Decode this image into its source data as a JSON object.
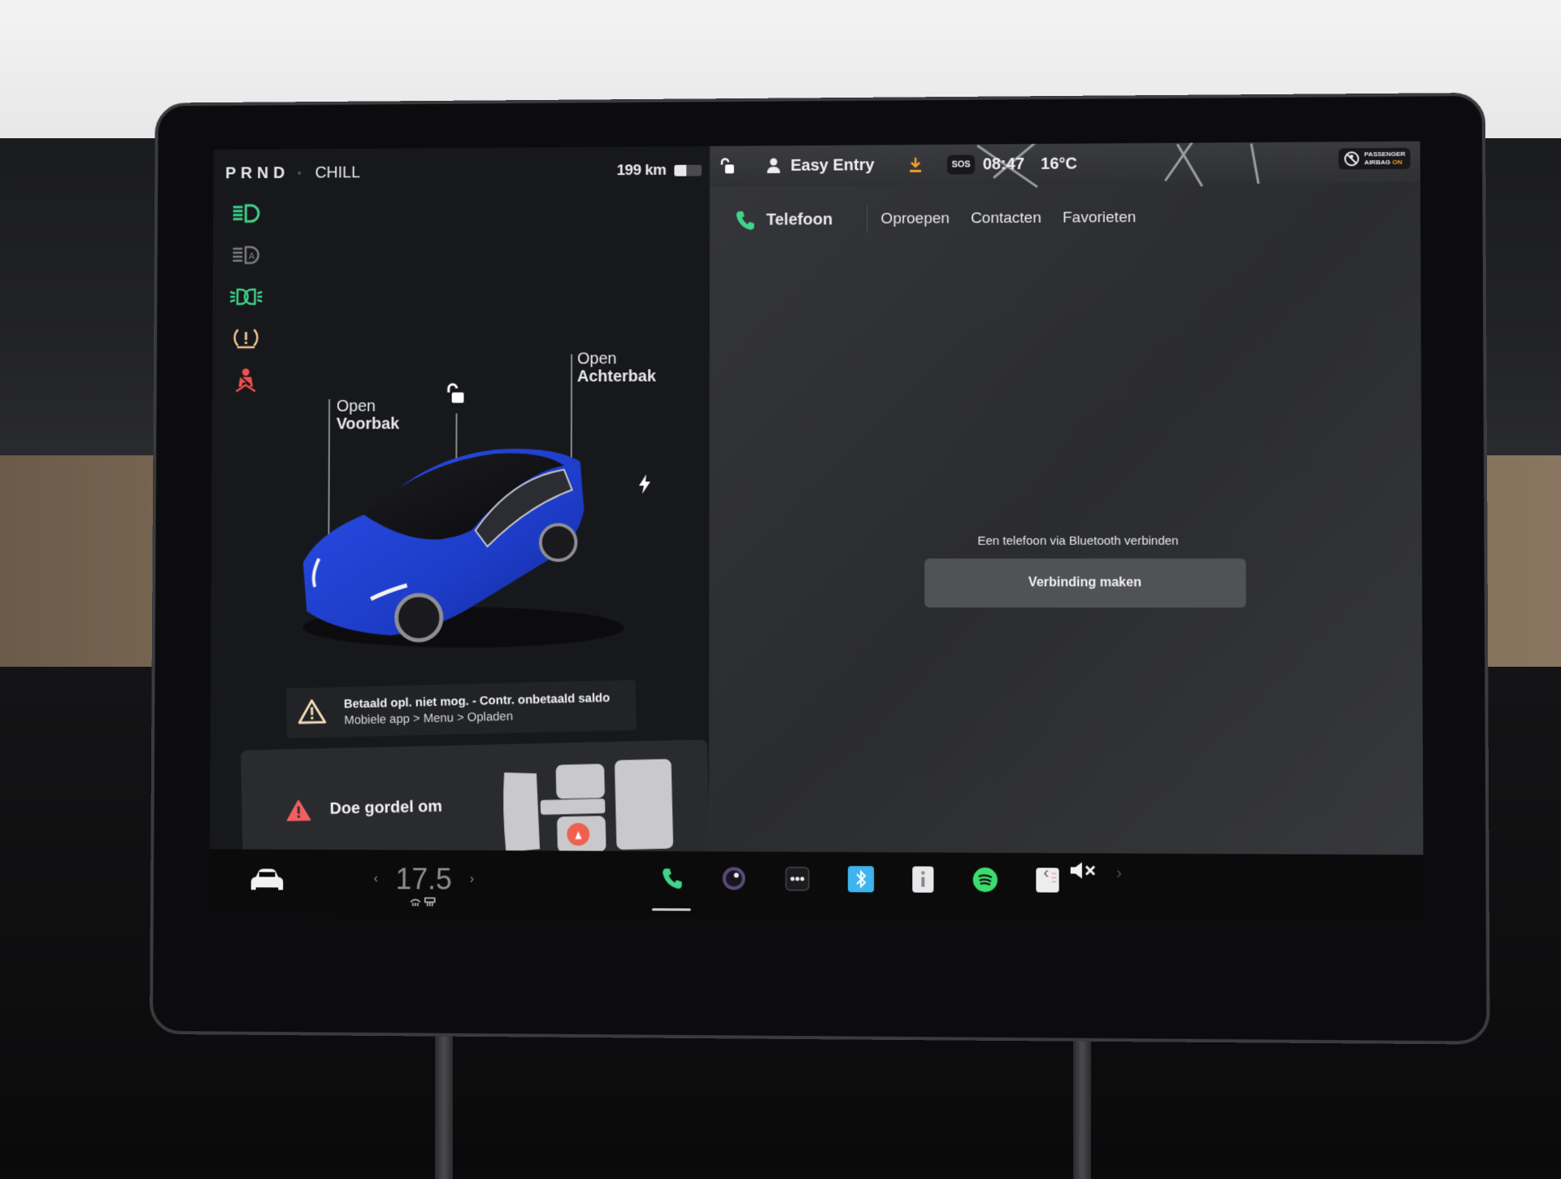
{
  "status_left": {
    "gear": "PRND",
    "drive_mode": "CHILL",
    "range": "199 km",
    "battery_level": 0.45
  },
  "telltales": [
    {
      "name": "low-beam-icon",
      "color": "#3fd48a"
    },
    {
      "name": "auto-high-beam-icon",
      "color": "#7c7c82"
    },
    {
      "name": "parking-lights-icon",
      "color": "#3fd48a"
    },
    {
      "name": "tire-pressure-icon",
      "color": "#f2c68e"
    },
    {
      "name": "seatbelt-icon",
      "color": "#f05050"
    }
  ],
  "car_view": {
    "frunk": {
      "line1": "Open",
      "line2": "Voorbak"
    },
    "trunk": {
      "line1": "Open",
      "line2": "Achterbak"
    },
    "lock_state": "unlocked",
    "charge_port_icon": "lightning-icon",
    "car_color": "#1e3fcf"
  },
  "charging_alert": {
    "title": "Betaald opl. niet mog. - Contr. onbetaald saldo",
    "subtitle": "Mobiele app > Menu > Opladen"
  },
  "seatbelt_alert": {
    "text": "Doe gordel om"
  },
  "status_right": {
    "driver_profile": "Easy Entry",
    "sos": "SOS",
    "time": "08:47",
    "temperature": "16°C",
    "airbag_line1": "PASSENGER",
    "airbag_line2": "AIRBAG",
    "airbag_state": "ON"
  },
  "phone": {
    "title": "Telefoon",
    "tabs": [
      "Oproepen",
      "Contacten",
      "Favorieten"
    ],
    "prompt": "Een telefoon via Bluetooth verbinden",
    "connect_button": "Verbinding maken"
  },
  "dock": {
    "cabin_temp": "17.5",
    "apps": [
      "phone",
      "camera",
      "more",
      "bluetooth",
      "manual",
      "spotify",
      "notes"
    ],
    "active_app": "phone",
    "volume_state": "muted"
  },
  "colors": {
    "accent_green": "#3fd48a",
    "warning_red": "#f05050",
    "warning_orange": "#f0a030",
    "bluetooth_blue": "#3db4ee",
    "spotify_green": "#3ddc6e"
  }
}
